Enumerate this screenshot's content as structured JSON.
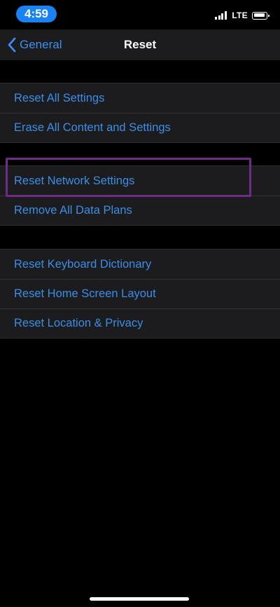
{
  "status_bar": {
    "time": "4:59",
    "network": "LTE",
    "time_pill_color": "#1a82f7"
  },
  "nav": {
    "back_label": "General",
    "title": "Reset"
  },
  "groups": [
    {
      "items": [
        {
          "label": "Reset All Settings"
        },
        {
          "label": "Erase All Content and Settings"
        }
      ]
    },
    {
      "items": [
        {
          "label": "Reset Network Settings",
          "highlighted": true
        },
        {
          "label": "Remove All Data Plans"
        }
      ]
    },
    {
      "items": [
        {
          "label": "Reset Keyboard Dictionary"
        },
        {
          "label": "Reset Home Screen Layout"
        },
        {
          "label": "Reset Location & Privacy"
        }
      ]
    }
  ],
  "colors": {
    "link": "#3a8ee6",
    "highlight_box": "#6f2b86",
    "background": "#000000",
    "cell": "#1c1c1e"
  },
  "icons": [
    "chevron-left-icon",
    "cellular-signal-icon",
    "battery-icon"
  ]
}
